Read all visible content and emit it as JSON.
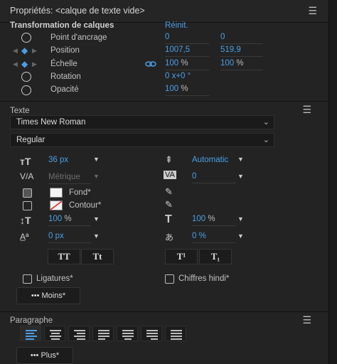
{
  "panel": {
    "title": "Propriétés: <calque de texte vide>"
  },
  "transform": {
    "title": "Transformation de calques",
    "reset": "Réinit.",
    "rows": [
      {
        "label": "Point d'ancrage",
        "v1": "0",
        "v2": "0"
      },
      {
        "label": "Position",
        "v1": "1007,5",
        "v2": "519,9"
      },
      {
        "label": "Échelle",
        "v1": "100",
        "u1": "%",
        "v2": "100",
        "u2": "%"
      },
      {
        "label": "Rotation",
        "v1": "0 x+0 °"
      },
      {
        "label": "Opacité",
        "v1": "100",
        "u1": "%"
      }
    ]
  },
  "texte": {
    "title": "Texte",
    "font": "Times New Roman",
    "style": "Regular",
    "size": "36 px",
    "leading": "Automatic",
    "kerning": "Métrique",
    "tracking": "0",
    "fill_label": "Fond*",
    "stroke_label": "Contour*",
    "vscale": "100",
    "vscale_unit": "%",
    "hscale": "100",
    "hscale_unit": "%",
    "baseline": "0 px",
    "tsume": "0 %",
    "caps_all": "TT",
    "caps_small": "Tt",
    "superscript": "T¹",
    "subscript": "T₁",
    "ligatures": "Ligatures*",
    "hindi": "Chiffres hindi*",
    "less": "••• Moins*"
  },
  "paragraphe": {
    "title": "Paragraphe",
    "more": "••• Plus*"
  },
  "colors": {
    "accent": "#4a9fe6",
    "bg": "#232323"
  }
}
